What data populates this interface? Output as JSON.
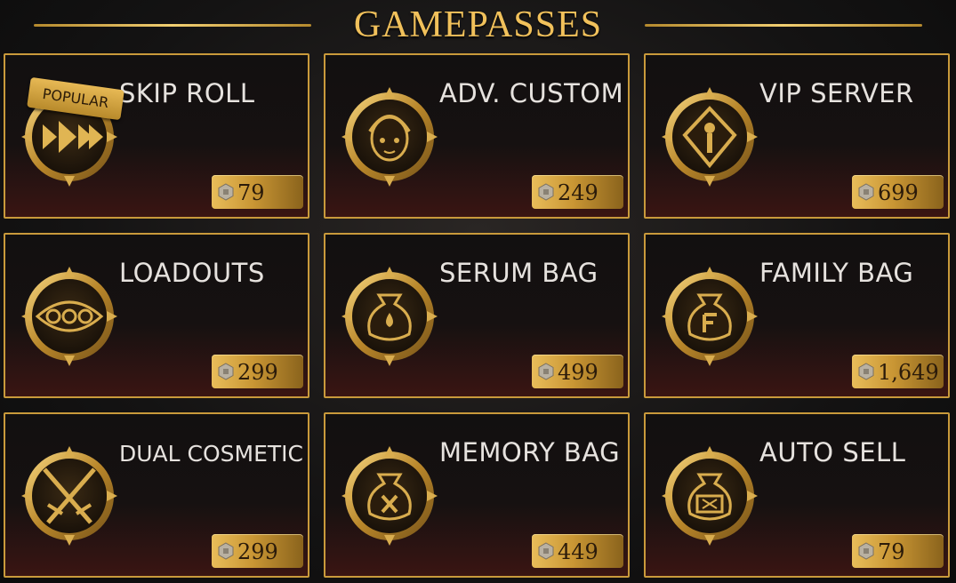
{
  "header": {
    "title": "GAMEPASSES"
  },
  "badge": {
    "label": "POPULAR"
  },
  "colors": {
    "gold": "#c99a3b",
    "title_gold": "#f1c15b",
    "card_bg_bottom": "#3a1512"
  },
  "cards": [
    {
      "title": "SKIP ROLL",
      "price": "79",
      "icon": "skip-arrows-icon"
    },
    {
      "title": "ADV. CUSTOM",
      "price": "249",
      "icon": "character-face-icon"
    },
    {
      "title": "VIP SERVER",
      "price": "699",
      "icon": "vip-crest-icon"
    },
    {
      "title": "LOADOUTS",
      "price": "299",
      "icon": "loadout-slots-icon"
    },
    {
      "title": "SERUM BAG",
      "price": "499",
      "icon": "serum-bag-icon"
    },
    {
      "title": "FAMILY BAG",
      "price": "1,649",
      "icon": "family-bag-icon"
    },
    {
      "title": "DUAL COSMETIC",
      "price": "299",
      "icon": "crossed-swords-icon"
    },
    {
      "title": "MEMORY BAG",
      "price": "449",
      "icon": "memory-bag-icon"
    },
    {
      "title": "AUTO SELL",
      "price": "79",
      "icon": "auto-sell-bag-icon"
    }
  ]
}
